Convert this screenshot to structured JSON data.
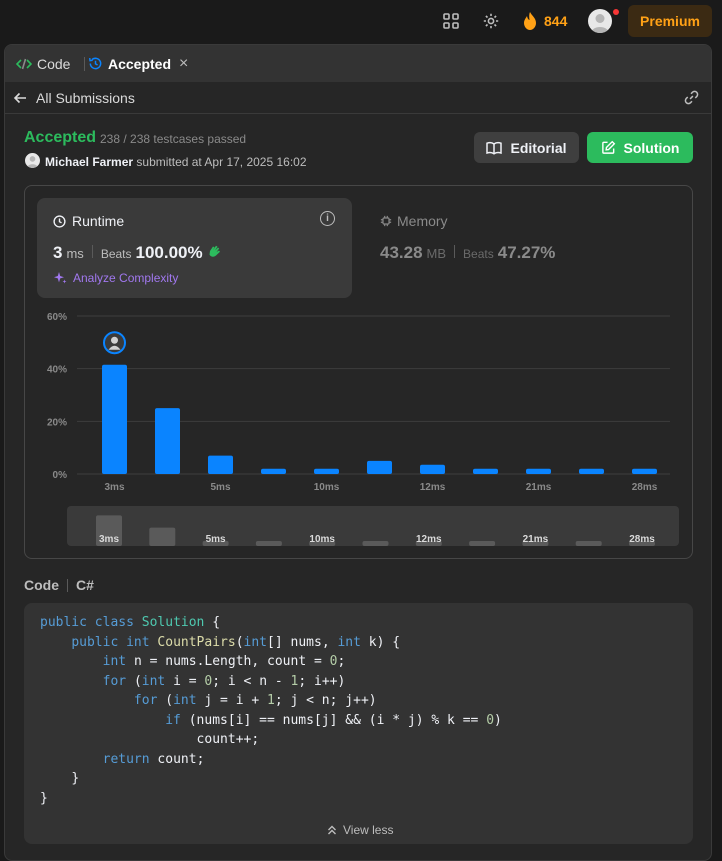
{
  "topbar": {
    "streak_count": "844",
    "premium_label": "Premium"
  },
  "tabs": {
    "code_label": "Code",
    "accepted_label": "Accepted"
  },
  "subnav": {
    "all_submissions": "All Submissions"
  },
  "submission": {
    "status": "Accepted",
    "testcases": "238 / 238 testcases passed",
    "author": "Michael Farmer",
    "submitted_text": "submitted at Apr 17, 2025 16:02"
  },
  "buttons": {
    "editorial": "Editorial",
    "solution": "Solution"
  },
  "runtime": {
    "title": "Runtime",
    "value": "3",
    "unit": "ms",
    "beats_label": "Beats",
    "beats_value": "100.00%",
    "analyze_label": "Analyze Complexity"
  },
  "memory": {
    "title": "Memory",
    "value": "43.28",
    "unit": "MB",
    "beats_label": "Beats",
    "beats_value": "47.27%"
  },
  "chart_data": {
    "type": "bar",
    "categories": [
      "3ms",
      "",
      "5ms",
      "",
      "10ms",
      "",
      "12ms",
      "",
      "21ms",
      "",
      "28ms"
    ],
    "values": [
      41.5,
      25,
      7,
      2,
      2,
      5,
      3.5,
      2,
      2,
      2,
      2
    ],
    "y_ticks": [
      "0%",
      "20%",
      "40%",
      "60%"
    ],
    "ylim": [
      0,
      60
    ],
    "highlight_index": 0,
    "bar_color": "#0a84ff",
    "grid": true
  },
  "code": {
    "label": "Code",
    "language": "C#",
    "lines": [
      "public class Solution {",
      "    public int CountPairs(int[] nums, int k) {",
      "        int n = nums.Length, count = 0;",
      "        for (int i = 0; i < n - 1; i++)",
      "            for (int j = i + 1; j < n; j++)",
      "                if (nums[i] == nums[j] && (i * j) % k == 0)",
      "                    count++;",
      "        return count;",
      "    }",
      "}"
    ],
    "view_less": "View less"
  },
  "colors": {
    "accent_green": "#2cbb5d",
    "bar_blue": "#0a84ff",
    "premium_orange": "#ffa116"
  }
}
